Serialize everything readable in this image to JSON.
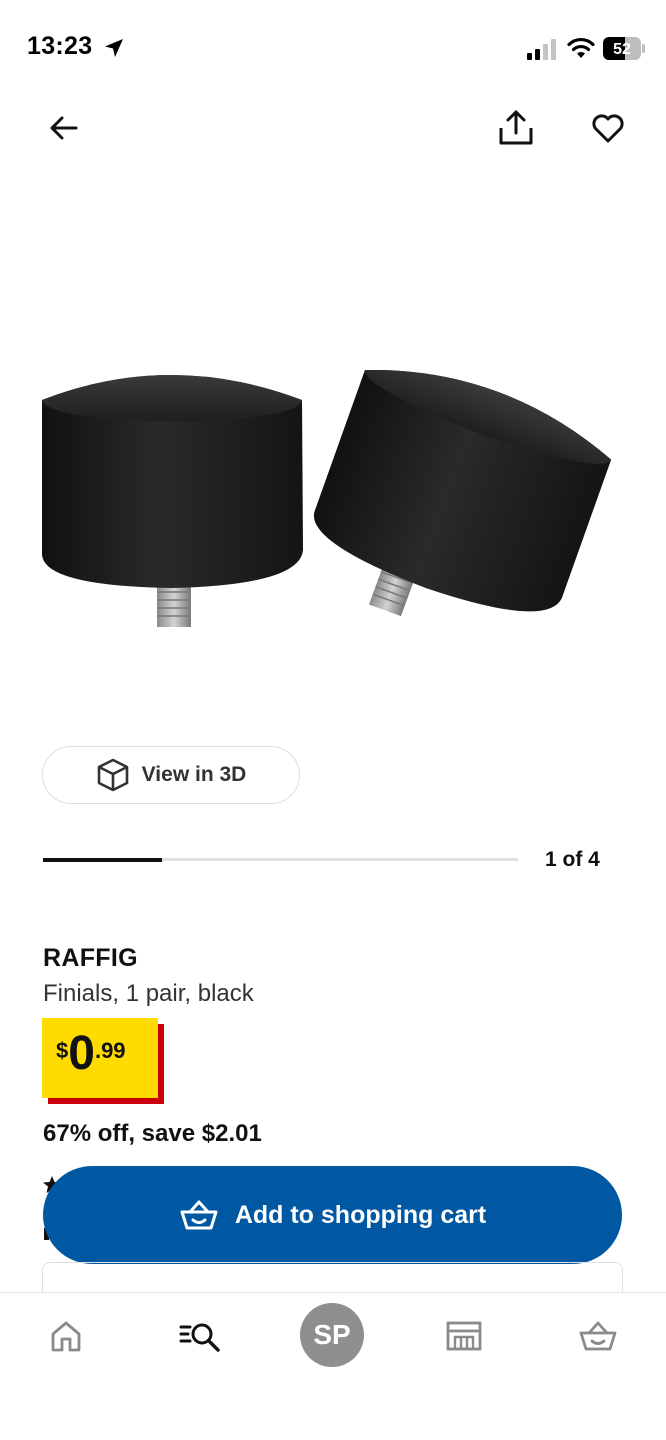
{
  "status_bar": {
    "time": "13:23",
    "battery": "52"
  },
  "header": {
    "back_icon": "arrow-left-icon",
    "share_icon": "share-icon",
    "favorite_icon": "heart-outline-icon"
  },
  "gallery": {
    "view_3d_label": "View in 3D",
    "counter": "1 of 4",
    "current_image": 1,
    "total_images": 4
  },
  "product": {
    "name": "RAFFIG",
    "description": "Finials, 1 pair, black",
    "price": {
      "currency": "$",
      "integer": "0",
      "decimal": ".99"
    },
    "discount": "67% off, save $2.01"
  },
  "cta": {
    "add_to_cart_label": "Add to shopping cart"
  },
  "tab_bar": {
    "tabs": [
      {
        "name": "home",
        "icon": "home-icon"
      },
      {
        "name": "search",
        "icon": "search-icon"
      },
      {
        "name": "profile",
        "initials": "SP"
      },
      {
        "name": "stores",
        "icon": "store-icon"
      },
      {
        "name": "cart",
        "icon": "basket-icon"
      }
    ]
  },
  "colors": {
    "brand_blue": "#0058a3",
    "price_yellow": "#ffdb00",
    "price_red": "#cc0008",
    "profile_gray": "#8f8f8f"
  }
}
